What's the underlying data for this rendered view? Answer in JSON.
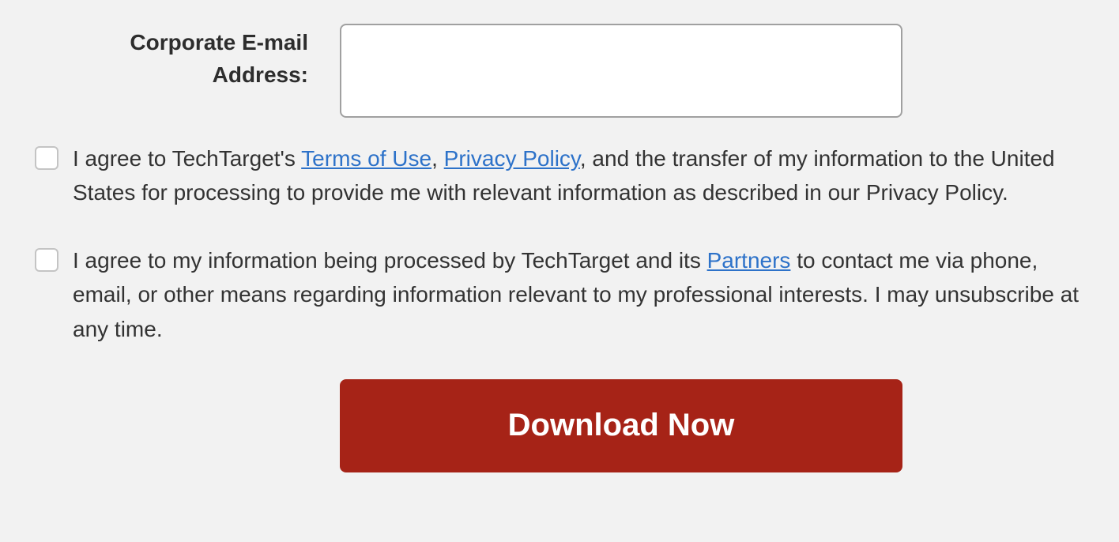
{
  "form": {
    "email_label": "Corporate E-mail Address:",
    "email_value": ""
  },
  "consents": {
    "c1": {
      "pre": "I agree to TechTarget's ",
      "link1": "Terms of Use",
      "sep1": ", ",
      "link2": "Privacy Policy",
      "post": ", and the transfer of my information to the United States for processing to provide me with relevant information as described in our Privacy Policy."
    },
    "c2": {
      "pre": "I agree to my information being processed by TechTarget and its ",
      "link1": "Partners",
      "post": " to contact me via phone, email, or other means regarding information relevant to my professional interests. I may unsubscribe at any time."
    }
  },
  "actions": {
    "download": "Download Now"
  },
  "colors": {
    "accent": "#a62317",
    "link": "#2d72c9"
  }
}
